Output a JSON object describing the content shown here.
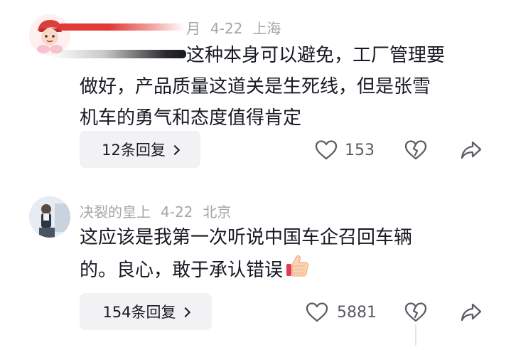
{
  "comments": [
    {
      "author": "",
      "date": "4-22",
      "location": "上海",
      "name_fragment": "月",
      "text_lines": [
        "这种本身可以避免，工厂管理要",
        "做好，产品质量这道关是生死线，但是张雪",
        "机车的勇气和态度值得肯定"
      ],
      "reply_label": "12条回复",
      "like_count": "153"
    },
    {
      "author": "决裂的皇上",
      "date": "4-22",
      "location": "北京",
      "text_lines": [
        "这应该是我第一次听说中国车企召回车辆",
        "的。良心，敢于承认错误"
      ],
      "emoji": "👍",
      "reply_label": "154条回复",
      "like_count": "5881"
    }
  ],
  "icons": {
    "like": "heart-outline-icon",
    "dislike": "broken-heart-icon",
    "share": "share-arrow-icon",
    "chevron": "chevron-right-icon"
  },
  "colors": {
    "meta_text": "#a4a5aa",
    "reply_bg": "#f2f2f4",
    "accent_red": "#e23a36"
  }
}
